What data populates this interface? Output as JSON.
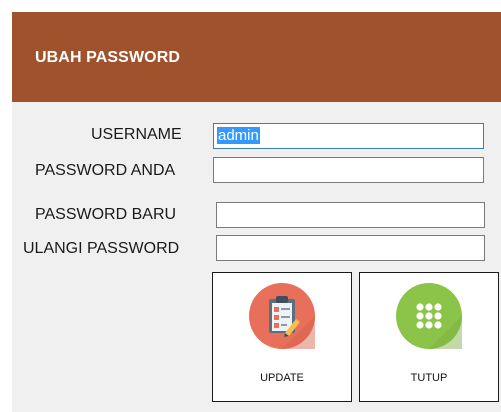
{
  "header": {
    "title": "UBAH PASSWORD"
  },
  "form": {
    "username_label": "USERNAME",
    "username_value": "admin",
    "current_password_label": "PASSWORD ANDA",
    "current_password_value": "",
    "new_password_label": "PASSWORD BARU",
    "new_password_value": "",
    "repeat_password_label": "ULANGI PASSWORD",
    "repeat_password_value": ""
  },
  "buttons": {
    "update_label": "UPDATE",
    "update_icon": "clipboard-checklist-icon",
    "close_label": "TUTUP",
    "close_icon": "app-grid-icon"
  },
  "colors": {
    "header_bg": "#a0522d",
    "update_icon_bg": "#e8705a",
    "close_icon_bg": "#8cc44a"
  }
}
